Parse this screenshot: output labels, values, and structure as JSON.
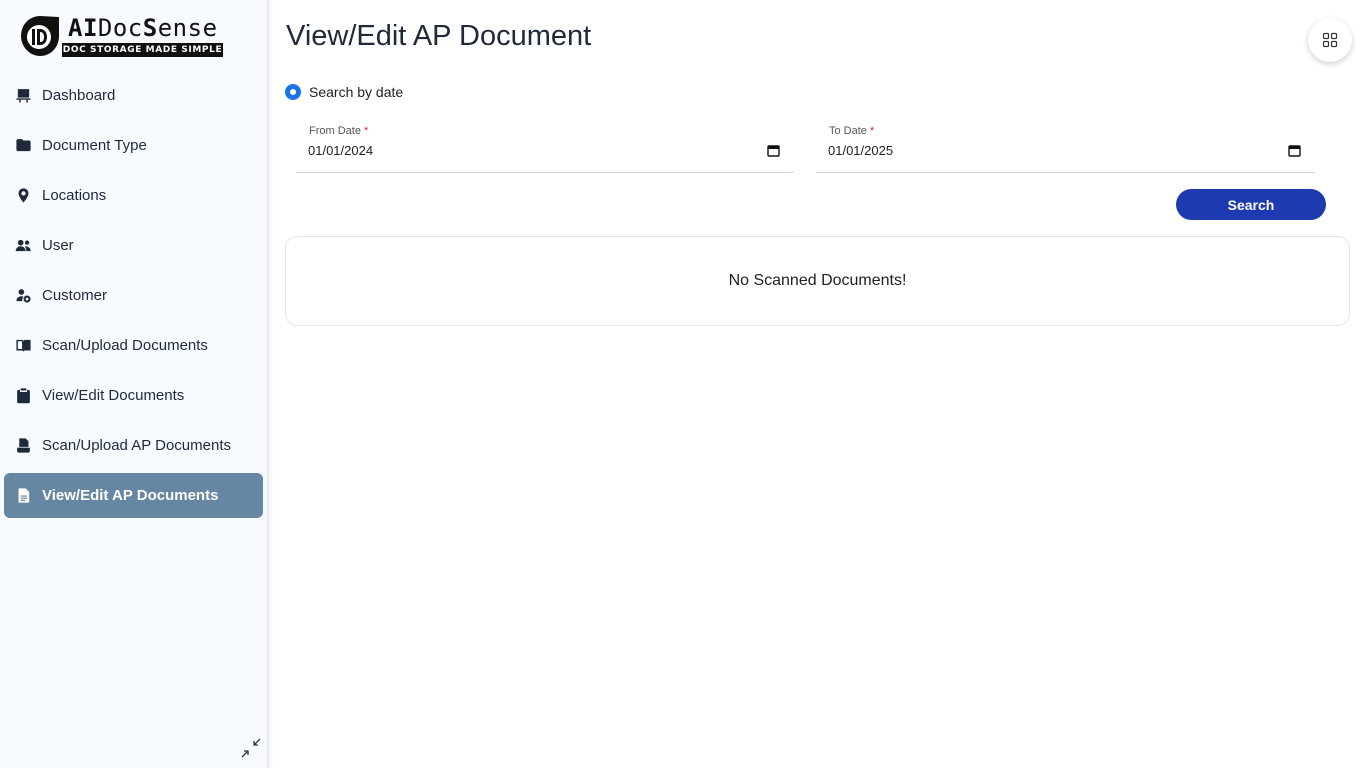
{
  "brand": {
    "name_part1": "AI",
    "name_part2": "Doc",
    "name_part3": "S",
    "name_part4": "ense",
    "tagline": "DOC STORAGE MADE SIMPLE"
  },
  "sidebar": {
    "items": [
      {
        "label": "Dashboard",
        "icon": "dashboard-icon",
        "active": false
      },
      {
        "label": "Document Type",
        "icon": "folder-icon",
        "active": false
      },
      {
        "label": "Locations",
        "icon": "location-pin-icon",
        "active": false
      },
      {
        "label": "User",
        "icon": "users-icon",
        "active": false
      },
      {
        "label": "Customer",
        "icon": "customer-settings-icon",
        "active": false
      },
      {
        "label": "Scan/Upload Documents",
        "icon": "book-icon",
        "active": false
      },
      {
        "label": "View/Edit Documents",
        "icon": "clipboard-icon",
        "active": false
      },
      {
        "label": "Scan/Upload AP Documents",
        "icon": "scanner-icon",
        "active": false
      },
      {
        "label": "View/Edit AP Documents",
        "icon": "document-icon",
        "active": true
      }
    ]
  },
  "main": {
    "title": "View/Edit AP Document",
    "search_mode_label": "Search by date",
    "from_date": {
      "label": "From Date",
      "required_mark": "*",
      "value": "01/01/2024"
    },
    "to_date": {
      "label": "To Date",
      "required_mark": "*",
      "value": "01/01/2025"
    },
    "search_button": "Search",
    "empty_message": "No Scanned Documents!"
  },
  "colors": {
    "active_nav": "#6786a3",
    "primary_button": "#1d3ab0",
    "radio": "#1a73e8",
    "required": "#e11d48"
  }
}
